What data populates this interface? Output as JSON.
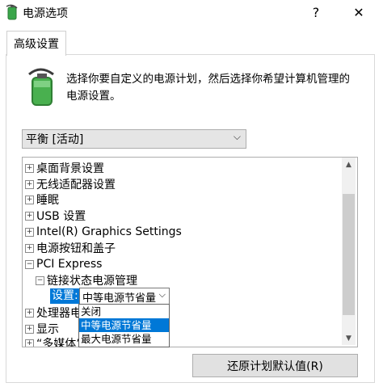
{
  "window": {
    "title": "电源选项",
    "help_glyph": "?",
    "close_glyph": "✕"
  },
  "tabs": [
    {
      "label": "高级设置"
    }
  ],
  "description": "选择你要自定义的电源计划，然后选择你希望计算机管理的电源设置。",
  "plan_select": {
    "value": "平衡 [活动]",
    "arrow": "⌵"
  },
  "tree": [
    {
      "label": "桌面背景设置",
      "expander": "+"
    },
    {
      "label": "无线适配器设置",
      "expander": "+"
    },
    {
      "label": "睡眠",
      "expander": "+"
    },
    {
      "label": "USB 设置",
      "expander": "+"
    },
    {
      "label": "Intel(R) Graphics Settings",
      "expander": "+"
    },
    {
      "label": "电源按钮和盖子",
      "expander": "+"
    },
    {
      "label": "PCI Express",
      "expander": "−"
    },
    {
      "label": "链接状态电源管理",
      "expander": "−"
    },
    {
      "label": "处理器电",
      "expander": "+"
    },
    {
      "label": "显示",
      "expander": "+"
    },
    {
      "label": "“多媒体”设置",
      "expander": "+"
    }
  ],
  "setting": {
    "label": "设置:",
    "value": "中等电源节省量",
    "arrow": "⌵",
    "options": [
      "关闭",
      "中等电源节省量",
      "最大电源节省量"
    ],
    "selected_index": 1
  },
  "scrollbar": {
    "up": "▲",
    "down": "▼"
  },
  "restore_button": "还原计划默认值(R)",
  "colors": {
    "accent": "#0078d7",
    "icon_green": "#3aa64a"
  }
}
